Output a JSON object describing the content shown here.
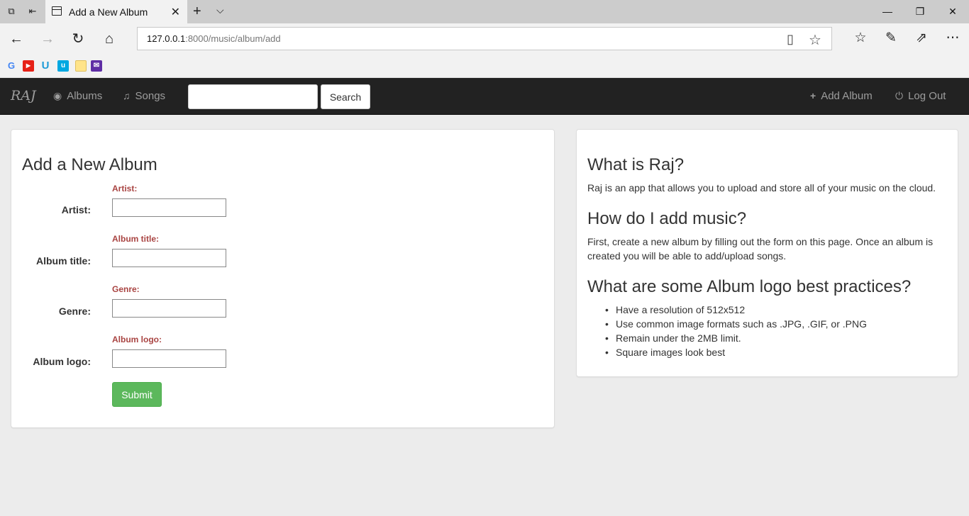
{
  "browser": {
    "tab_title": "Add a New Album",
    "url_host": "127.0.0.1",
    "url_rest": ":8000/music/album/add",
    "window_controls": {
      "minimize": "—",
      "maximize": "❐",
      "close": "✕"
    }
  },
  "navbar": {
    "brand": "RAJ",
    "links": [
      {
        "label": "Albums",
        "icon": "disc-icon"
      },
      {
        "label": "Songs",
        "icon": "music-note-icon"
      }
    ],
    "search": {
      "value": "",
      "button_label": "Search"
    },
    "right_links": [
      {
        "label": "Add Album",
        "icon": "plus-icon"
      },
      {
        "label": "Log Out",
        "icon": "power-icon"
      }
    ],
    "colors": {
      "background": "#222222",
      "link": "#9d9d9d"
    }
  },
  "form": {
    "title": "Add a New Album",
    "fields": [
      {
        "error": "Artist:",
        "label": "Artist:",
        "value": ""
      },
      {
        "error": "Album title:",
        "label": "Album title:",
        "value": ""
      },
      {
        "error": "Genre:",
        "label": "Genre:",
        "value": ""
      },
      {
        "error": "Album logo:",
        "label": "Album logo:",
        "value": ""
      }
    ],
    "submit_label": "Submit",
    "colors": {
      "error": "#a94442",
      "submit": "#5cb85c"
    }
  },
  "sidebar": {
    "q1": "What is Raj?",
    "a1": "Raj is an app that allows you to upload and store all of your music on the cloud.",
    "q2": "How do I add music?",
    "a2_line1": "First, create a new album by filling out the form on this page. Once an album is",
    "a2_line2": "created you will be able to add/upload songs.",
    "q3": "What are some Album logo best practices?",
    "tips": [
      "Have a resolution of 512x512",
      "Use common image formats such as .JPG, .GIF, or .PNG",
      "Remain under the 2MB limit.",
      "Square images look best"
    ]
  }
}
